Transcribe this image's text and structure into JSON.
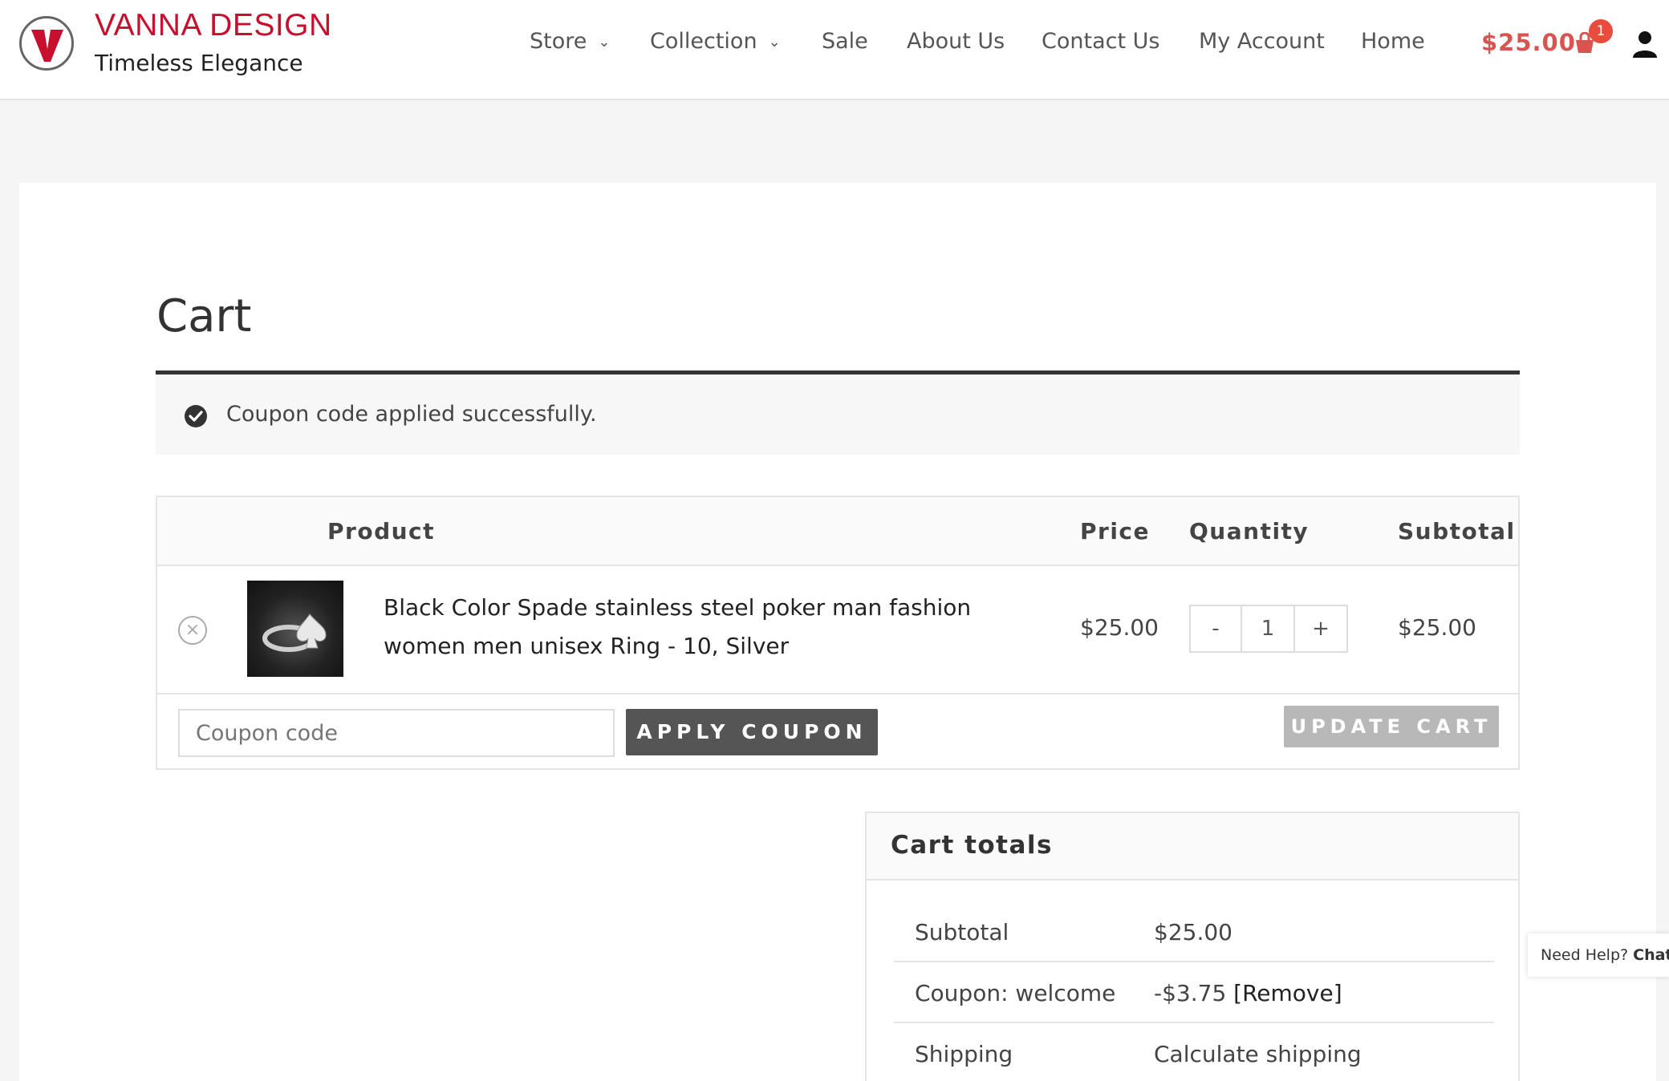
{
  "brand": {
    "name": "VANNA DESIGN",
    "tagline": "Timeless Elegance",
    "logo_letter": "V"
  },
  "nav": {
    "items": [
      {
        "label": "Store",
        "has_dropdown": true
      },
      {
        "label": "Collection",
        "has_dropdown": true
      },
      {
        "label": "Sale",
        "has_dropdown": false
      },
      {
        "label": "About Us",
        "has_dropdown": false
      },
      {
        "label": "Contact Us",
        "has_dropdown": false
      },
      {
        "label": "My Account",
        "has_dropdown": false
      },
      {
        "label": "Home",
        "has_dropdown": false
      }
    ],
    "cart_total": "$25.00",
    "cart_count": "1",
    "icons": {
      "cart": "cart-icon",
      "user": "user-icon",
      "dropdown": "chevron-down-icon"
    }
  },
  "page": {
    "title": "Cart",
    "notice": "Coupon code applied successfully."
  },
  "cart_table": {
    "headers": {
      "product": "Product",
      "price": "Price",
      "quantity": "Quantity",
      "subtotal": "Subtotal"
    },
    "items": [
      {
        "name": "Black Color Spade stainless steel poker man fashion women men unisex Ring - 10, Silver",
        "price": "$25.00",
        "quantity": "1",
        "subtotal": "$25.00"
      }
    ],
    "qty_minus": "-",
    "qty_plus": "+",
    "remove_glyph": "×"
  },
  "actions": {
    "coupon_placeholder": "Coupon code",
    "apply_label": "APPLY COUPON",
    "update_label": "UPDATE CART"
  },
  "totals": {
    "title": "Cart totals",
    "rows": [
      {
        "label": "Subtotal",
        "value": "$25.00"
      },
      {
        "label": "Coupon: welcome",
        "value": "-$3.75",
        "link": "[Remove]"
      },
      {
        "label": "Shipping",
        "value": "Calculate shipping"
      }
    ]
  },
  "help": {
    "text": "Need Help?",
    "bold": "Chat w"
  },
  "colors": {
    "brand_red": "#c8102e",
    "cart_red": "#d9534f",
    "button_dark": "#555555",
    "button_disabled": "#b8b8b8"
  }
}
